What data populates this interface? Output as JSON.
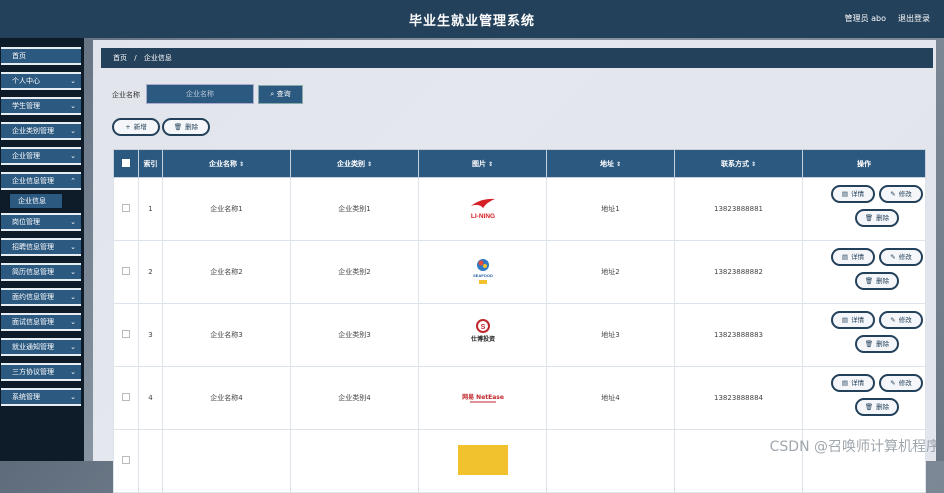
{
  "app": {
    "title": "毕业生就业管理系统",
    "admin_label": "管理员 abo",
    "logout_label": "退出登录"
  },
  "sidebar": {
    "items": [
      {
        "label": "首页",
        "chevron": false
      },
      {
        "label": "个人中心",
        "chevron": true
      },
      {
        "label": "学生管理",
        "chevron": true
      },
      {
        "label": "企业类别管理",
        "chevron": true
      },
      {
        "label": "企业管理",
        "chevron": true
      },
      {
        "label": "企业信息管理",
        "chevron": true
      },
      {
        "label": "岗位管理",
        "chevron": true
      },
      {
        "label": "招聘信息管理",
        "chevron": true
      },
      {
        "label": "简历信息管理",
        "chevron": true
      },
      {
        "label": "面约信息管理",
        "chevron": true
      },
      {
        "label": "面试信息管理",
        "chevron": true
      },
      {
        "label": "就业通知管理",
        "chevron": true
      },
      {
        "label": "三方协议管理",
        "chevron": true
      },
      {
        "label": "系统管理",
        "chevron": true
      }
    ],
    "active_sub": "企业信息"
  },
  "breadcrumb": {
    "home": "首页",
    "sep": "/",
    "current": "企业信息"
  },
  "search": {
    "label": "企业名称",
    "placeholder": "企业名称",
    "query_button": "查询"
  },
  "actions": {
    "add": "新增",
    "delete": "删除"
  },
  "table": {
    "headers": [
      "索引",
      "企业名称",
      "企业类别",
      "图片",
      "地址",
      "联系方式",
      "操作"
    ],
    "rows": [
      {
        "index": "1",
        "name": "企业名称1",
        "category": "企业类别1",
        "address": "地址1",
        "phone": "13823888881",
        "logo": "li-ning-logo",
        "logo_text": "LI-NING"
      },
      {
        "index": "2",
        "name": "企业名称2",
        "category": "企业类别2",
        "address": "地址2",
        "phone": "13823888882",
        "logo": "seafood-logo",
        "logo_text": "SEAFOOD"
      },
      {
        "index": "3",
        "name": "企业名称3",
        "category": "企业类别3",
        "address": "地址3",
        "phone": "13823888883",
        "logo": "investment-logo",
        "logo_text": "仕博投资"
      },
      {
        "index": "4",
        "name": "企业名称4",
        "category": "企业类别4",
        "address": "地址4",
        "phone": "13823888884",
        "logo": "netease-logo",
        "logo_text": "网易 NetEase"
      }
    ],
    "row_actions": {
      "detail": "详情",
      "edit": "修改",
      "delete": "删除"
    }
  },
  "watermark": "CSDN @召唤师计算机程序",
  "colors": {
    "header_bg": "#23415a",
    "nav_item_bg": "#2c5980",
    "table_header_bg": "#2c5980"
  }
}
